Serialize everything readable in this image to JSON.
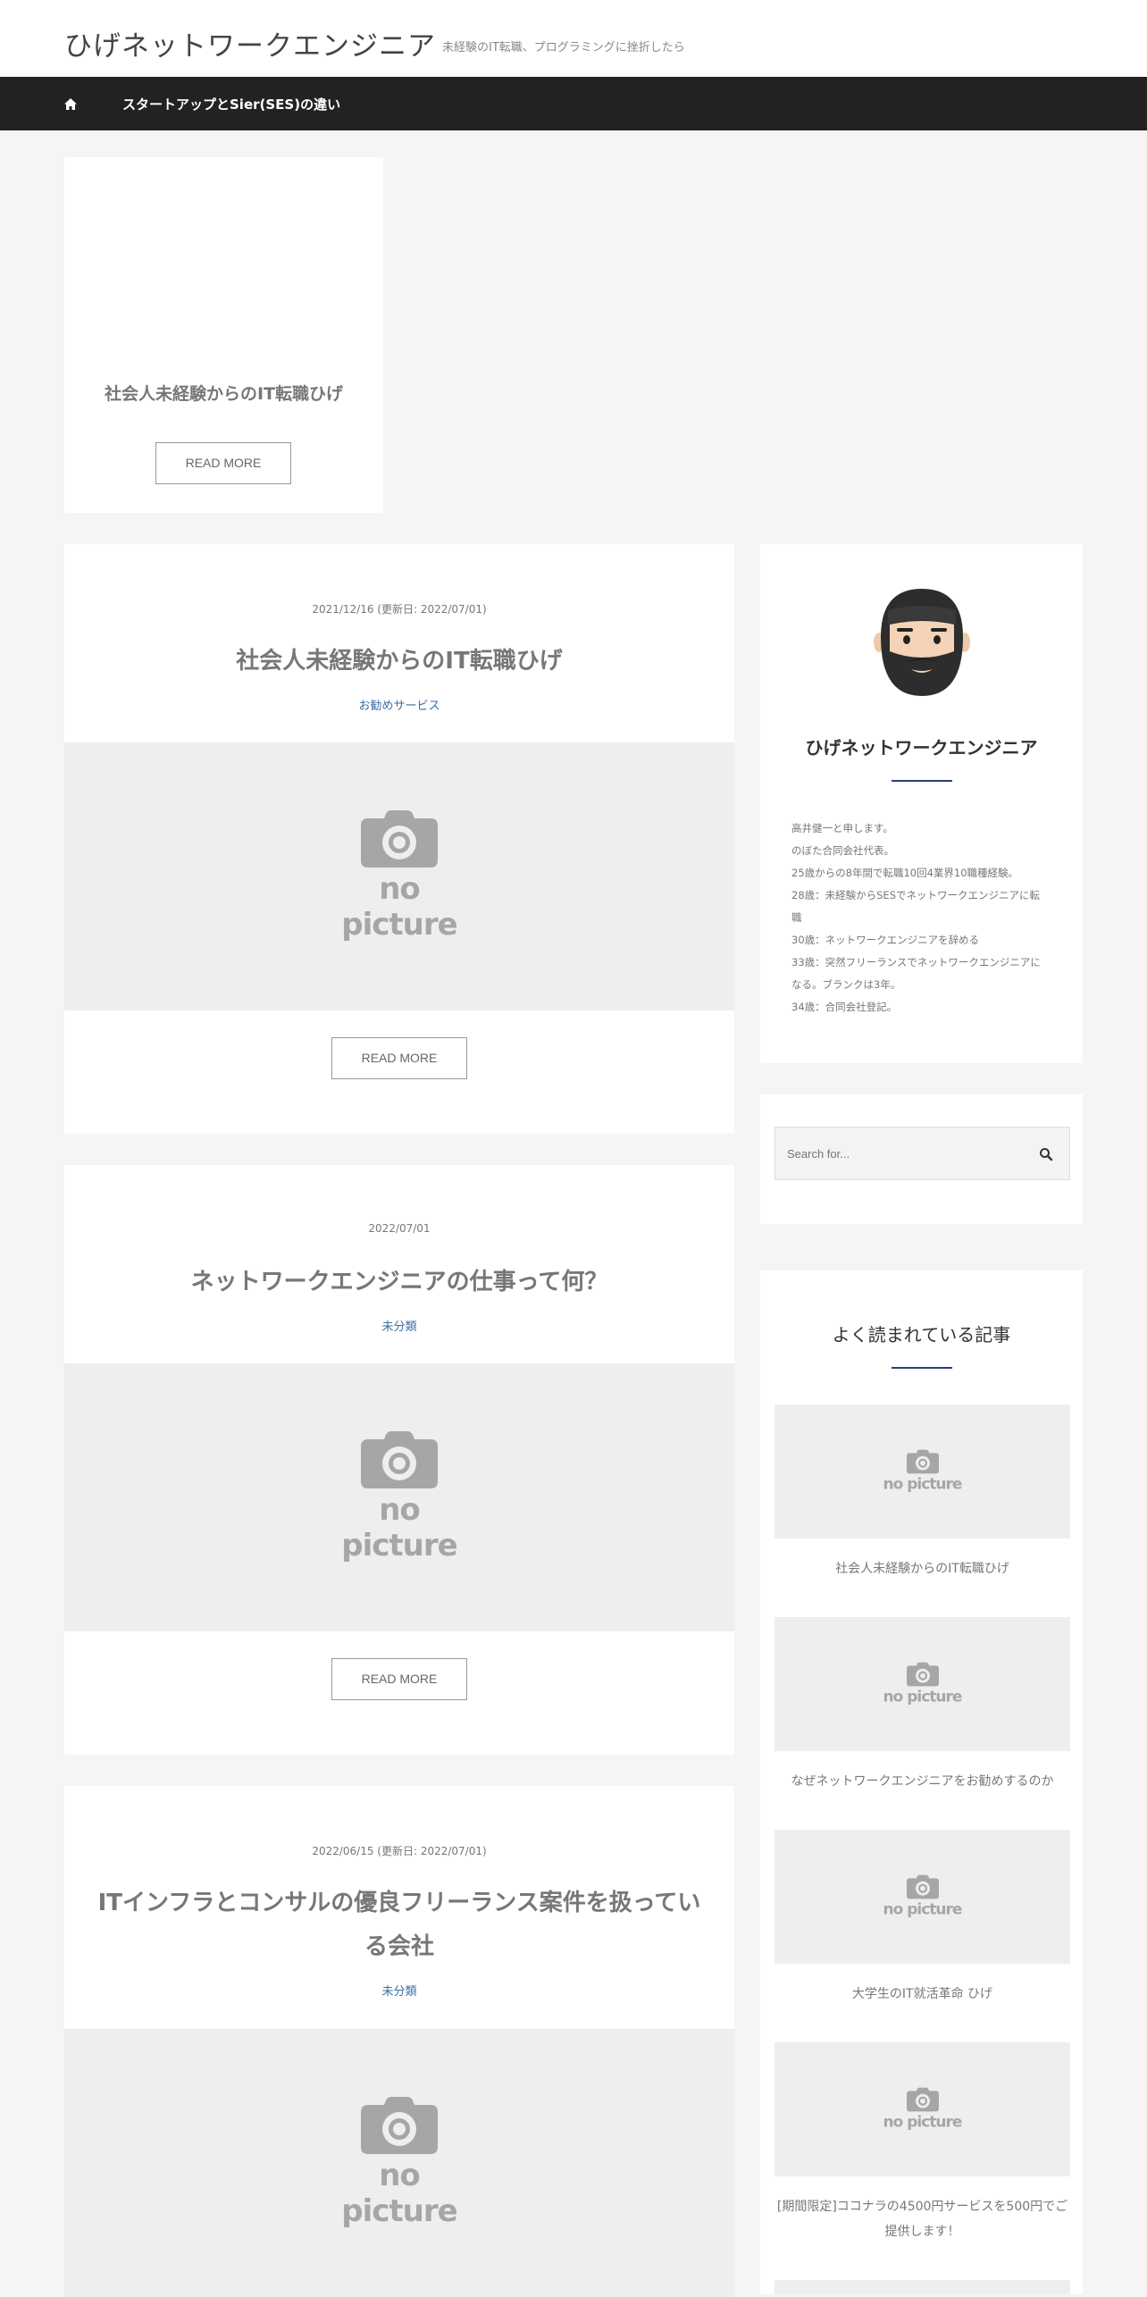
{
  "header": {
    "site_title": "ひげネットワークエンジニア",
    "site_description": "未経験のIT転職、プログラミングに挫折したら"
  },
  "nav": {
    "home_icon": "home-icon",
    "link_label": "スタートアップとSier(SES)の違い"
  },
  "featured": {
    "title": "社会人未経験からのIT転職󠄀󠄀ひげ",
    "button": "READ MORE"
  },
  "posts": [
    {
      "date": "2021/12/16 (更新日: 2022/07/01)",
      "title": "社会人未経験からのIT転職󠄀󠄀ひげ",
      "category": "お勧めサービス",
      "thumb_text": "no picture",
      "button": "READ MORE"
    },
    {
      "date": "2022/07/01",
      "title": "ネットワークエンジニアの仕事って何？",
      "category": "未分類",
      "thumb_text": "no picture",
      "button": "READ MORE"
    },
    {
      "date": "2022/06/15 (更新日: 2022/07/01)",
      "title": "ITインフラとコンサルの優良フリーランス案件を扱っている会社",
      "category": "未分類",
      "thumb_text": "no picture"
    }
  ],
  "profile": {
    "avatar_icon": "bearded-man-emoji-icon",
    "name": "ひげネットワークエンジニア",
    "lines": [
      "高井健一と申します。",
      "のぼた合同会社代表。",
      "25歳からの8年間で転職10回4業界10職種経験。",
      "28歳：未経験からSESでネットワークエンジニアに転",
      "職",
      "30歳：ネットワークエンジニアを辞める",
      "33歳：突然フリーランスでネットワークエンジニアに",
      "なる。ブランクは3年。",
      "34歳：合同会社登記。"
    ]
  },
  "search": {
    "placeholder": "Search for...",
    "icon": "search-icon"
  },
  "popular": {
    "title": "よく読まれている記事",
    "thumb_text": "no picture",
    "items": [
      "社会人未経験からのIT転職󠄀󠄀ひげ",
      "なぜネットワークエンジニアをお勧めするのか",
      "大学生のIT就活革命󠄀󠄀 ひげ",
      "[期間限定]ココナラの4500円サービスを500円でご提供します！"
    ]
  },
  "colors": {
    "nav_bg": "#222222",
    "accent": "#2b3f7a",
    "category_link": "#3a6ea5",
    "page_bg": "#f5f5f5"
  }
}
